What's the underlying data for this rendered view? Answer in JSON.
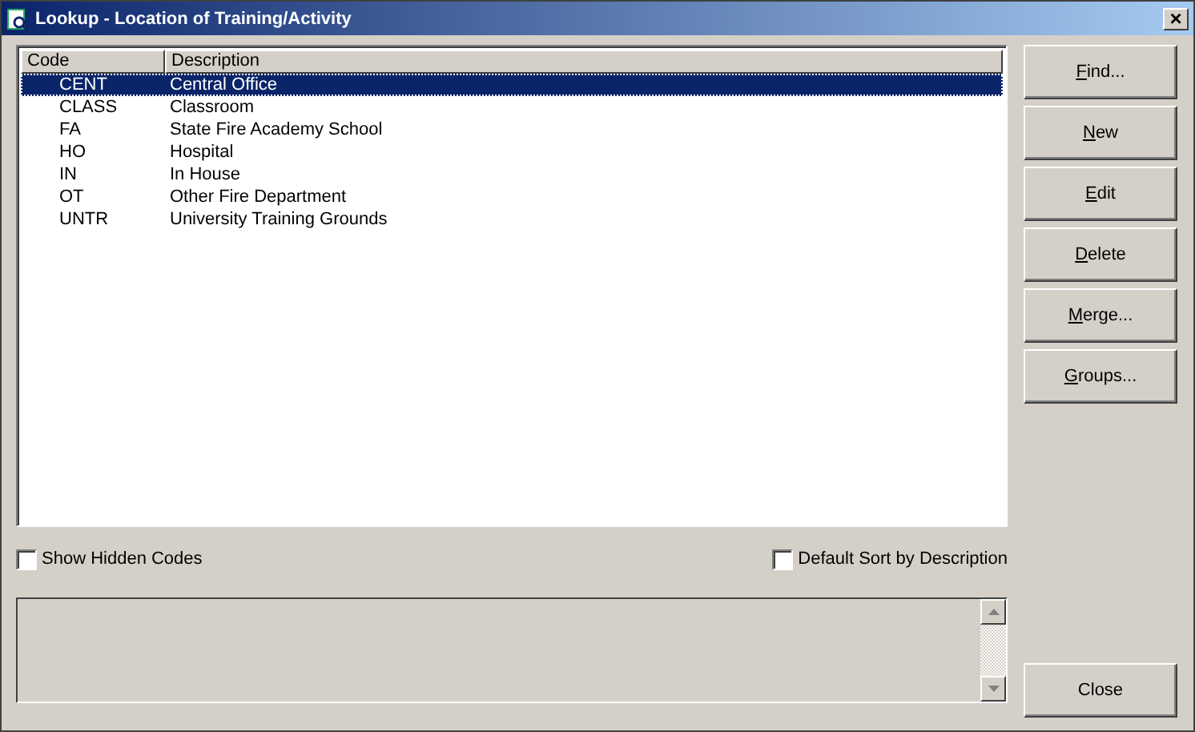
{
  "window": {
    "title": "Lookup - Location of Training/Activity",
    "close": "×"
  },
  "table": {
    "columns": [
      "Code",
      "Description"
    ],
    "rows": [
      {
        "code": "CENT",
        "description": "Central Office",
        "selected": true
      },
      {
        "code": "CLASS",
        "description": "Classroom",
        "selected": false
      },
      {
        "code": "FA",
        "description": "State Fire Academy School",
        "selected": false
      },
      {
        "code": "HO",
        "description": "Hospital",
        "selected": false
      },
      {
        "code": "IN",
        "description": "In House",
        "selected": false
      },
      {
        "code": "OT",
        "description": "Other Fire Department",
        "selected": false
      },
      {
        "code": "UNTR",
        "description": "University Training Grounds",
        "selected": false
      }
    ]
  },
  "buttons": [
    {
      "label": "Find...",
      "underlined_first": true
    },
    {
      "label": "New",
      "underlined_first": true
    },
    {
      "label": "Edit",
      "underlined_first": true
    },
    {
      "label": "Delete",
      "underlined_first": true
    },
    {
      "label": "Merge...",
      "underlined_first": true
    },
    {
      "label": "Groups...",
      "underlined_first": true
    }
  ],
  "checkboxes": [
    {
      "label": "Show Hidden Codes",
      "checked": false
    },
    {
      "label": "Default Sort by Description",
      "checked": false
    }
  ],
  "close_button": {
    "label": "Close",
    "underlined_first": false
  }
}
